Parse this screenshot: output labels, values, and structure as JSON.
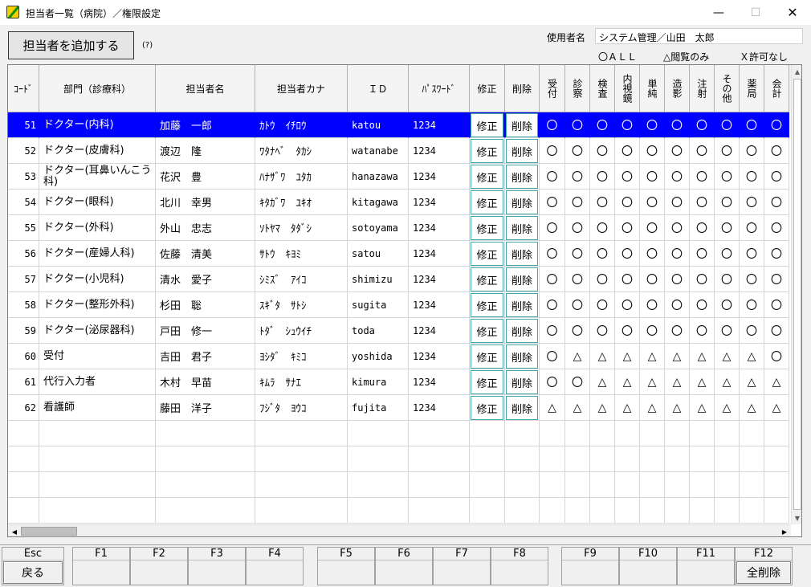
{
  "window": {
    "title": "担当者一覧（病院）／権限設定",
    "min_icon": "minimize-icon",
    "max_icon": "maximize-icon",
    "close_icon": "close-icon"
  },
  "toolbar": {
    "add_label": "担当者を追加する",
    "help_label": "(?)"
  },
  "user": {
    "label": "使用者名",
    "value": "システム管理／山田　太郎"
  },
  "legend": {
    "all": "〇ＡＬＬ",
    "view_only": "△閲覧のみ",
    "denied": "Ｘ許可なし"
  },
  "columns": {
    "code": "ｺｰﾄﾞ",
    "dept": "部門（診療科）",
    "name": "担当者名",
    "kana": "担当者カナ",
    "id": "ＩＤ",
    "password": "ﾊﾟｽﾜｰﾄﾞ",
    "edit": "修正",
    "delete": "削除",
    "perms": [
      "受付",
      "診察",
      "検査",
      "内視鏡",
      "単純",
      "造影",
      "注射",
      "その他",
      "薬局",
      "会計"
    ]
  },
  "rows": [
    {
      "code": "51",
      "dept": "ドクター(内科)",
      "name": "加藤　一郎",
      "kana": "ｶﾄｳ　ｲﾁﾛｳ",
      "id": "katou",
      "password": "1234",
      "edit": "修正",
      "delete": "削除",
      "perms": [
        "〇",
        "〇",
        "〇",
        "〇",
        "〇",
        "〇",
        "〇",
        "〇",
        "〇",
        "〇"
      ]
    },
    {
      "code": "52",
      "dept": "ドクター(皮膚科)",
      "name": "渡辺　隆",
      "kana": "ﾜﾀﾅﾍﾞ　ﾀｶｼ",
      "id": "watanabe",
      "password": "1234",
      "edit": "修正",
      "delete": "削除",
      "perms": [
        "〇",
        "〇",
        "〇",
        "〇",
        "〇",
        "〇",
        "〇",
        "〇",
        "〇",
        "〇"
      ]
    },
    {
      "code": "53",
      "dept": "ドクター(耳鼻いんこう科)",
      "name": "花沢　豊",
      "kana": "ﾊﾅｻﾞﾜ　ﾕﾀｶ",
      "id": "hanazawa",
      "password": "1234",
      "edit": "修正",
      "delete": "削除",
      "perms": [
        "〇",
        "〇",
        "〇",
        "〇",
        "〇",
        "〇",
        "〇",
        "〇",
        "〇",
        "〇"
      ]
    },
    {
      "code": "54",
      "dept": "ドクター(眼科)",
      "name": "北川　幸男",
      "kana": "ｷﾀｶﾞﾜ　ﾕｷｵ",
      "id": "kitagawa",
      "password": "1234",
      "edit": "修正",
      "delete": "削除",
      "perms": [
        "〇",
        "〇",
        "〇",
        "〇",
        "〇",
        "〇",
        "〇",
        "〇",
        "〇",
        "〇"
      ]
    },
    {
      "code": "55",
      "dept": "ドクター(外科)",
      "name": "外山　忠志",
      "kana": "ｿﾄﾔﾏ　ﾀﾀﾞｼ",
      "id": "sotoyama",
      "password": "1234",
      "edit": "修正",
      "delete": "削除",
      "perms": [
        "〇",
        "〇",
        "〇",
        "〇",
        "〇",
        "〇",
        "〇",
        "〇",
        "〇",
        "〇"
      ]
    },
    {
      "code": "56",
      "dept": "ドクター(産婦人科)",
      "name": "佐藤　清美",
      "kana": "ｻﾄｳ　ｷﾖﾐ",
      "id": "satou",
      "password": "1234",
      "edit": "修正",
      "delete": "削除",
      "perms": [
        "〇",
        "〇",
        "〇",
        "〇",
        "〇",
        "〇",
        "〇",
        "〇",
        "〇",
        "〇"
      ]
    },
    {
      "code": "57",
      "dept": "ドクター(小児科)",
      "name": "清水　愛子",
      "kana": "ｼﾐｽﾞ　ｱｲｺ",
      "id": "shimizu",
      "password": "1234",
      "edit": "修正",
      "delete": "削除",
      "perms": [
        "〇",
        "〇",
        "〇",
        "〇",
        "〇",
        "〇",
        "〇",
        "〇",
        "〇",
        "〇"
      ]
    },
    {
      "code": "58",
      "dept": "ドクター(整形外科)",
      "name": "杉田　聡",
      "kana": "ｽｷﾞﾀ　ｻﾄｼ",
      "id": "sugita",
      "password": "1234",
      "edit": "修正",
      "delete": "削除",
      "perms": [
        "〇",
        "〇",
        "〇",
        "〇",
        "〇",
        "〇",
        "〇",
        "〇",
        "〇",
        "〇"
      ]
    },
    {
      "code": "59",
      "dept": "ドクター(泌尿器科)",
      "name": "戸田　修一",
      "kana": "ﾄﾀﾞ　ｼｭｳｲﾁ",
      "id": "toda",
      "password": "1234",
      "edit": "修正",
      "delete": "削除",
      "perms": [
        "〇",
        "〇",
        "〇",
        "〇",
        "〇",
        "〇",
        "〇",
        "〇",
        "〇",
        "〇"
      ]
    },
    {
      "code": "60",
      "dept": "受付",
      "name": "吉田　君子",
      "kana": "ﾖｼﾀﾞ　ｷﾐｺ",
      "id": "yoshida",
      "password": "1234",
      "edit": "修正",
      "delete": "削除",
      "perms": [
        "〇",
        "△",
        "△",
        "△",
        "△",
        "△",
        "△",
        "△",
        "△",
        "〇"
      ]
    },
    {
      "code": "61",
      "dept": "代行入力者",
      "name": "木村　早苗",
      "kana": "ｷﾑﾗ　ｻﾅｴ",
      "id": "kimura",
      "password": "1234",
      "edit": "修正",
      "delete": "削除",
      "perms": [
        "〇",
        "〇",
        "△",
        "△",
        "△",
        "△",
        "△",
        "△",
        "△",
        "△"
      ]
    },
    {
      "code": "62",
      "dept": "看護師",
      "name": "藤田　洋子",
      "kana": "ﾌｼﾞﾀ　ﾖｳｺ",
      "id": "fujita",
      "password": "1234",
      "edit": "修正",
      "delete": "削除",
      "perms": [
        "△",
        "△",
        "△",
        "△",
        "△",
        "△",
        "△",
        "△",
        "△",
        "△"
      ]
    }
  ],
  "selected_row": 0,
  "fkeys": [
    {
      "key": "Esc",
      "label": "戻る"
    },
    {
      "key": "F1",
      "label": ""
    },
    {
      "key": "F2",
      "label": ""
    },
    {
      "key": "F3",
      "label": ""
    },
    {
      "key": "F4",
      "label": ""
    },
    {
      "key": "F5",
      "label": ""
    },
    {
      "key": "F6",
      "label": ""
    },
    {
      "key": "F7",
      "label": ""
    },
    {
      "key": "F8",
      "label": ""
    },
    {
      "key": "F9",
      "label": ""
    },
    {
      "key": "F10",
      "label": ""
    },
    {
      "key": "F11",
      "label": ""
    },
    {
      "key": "F12",
      "label": "全削除"
    }
  ],
  "colors": {
    "selection": "#0000ff",
    "button_border": "#40a8a8"
  }
}
